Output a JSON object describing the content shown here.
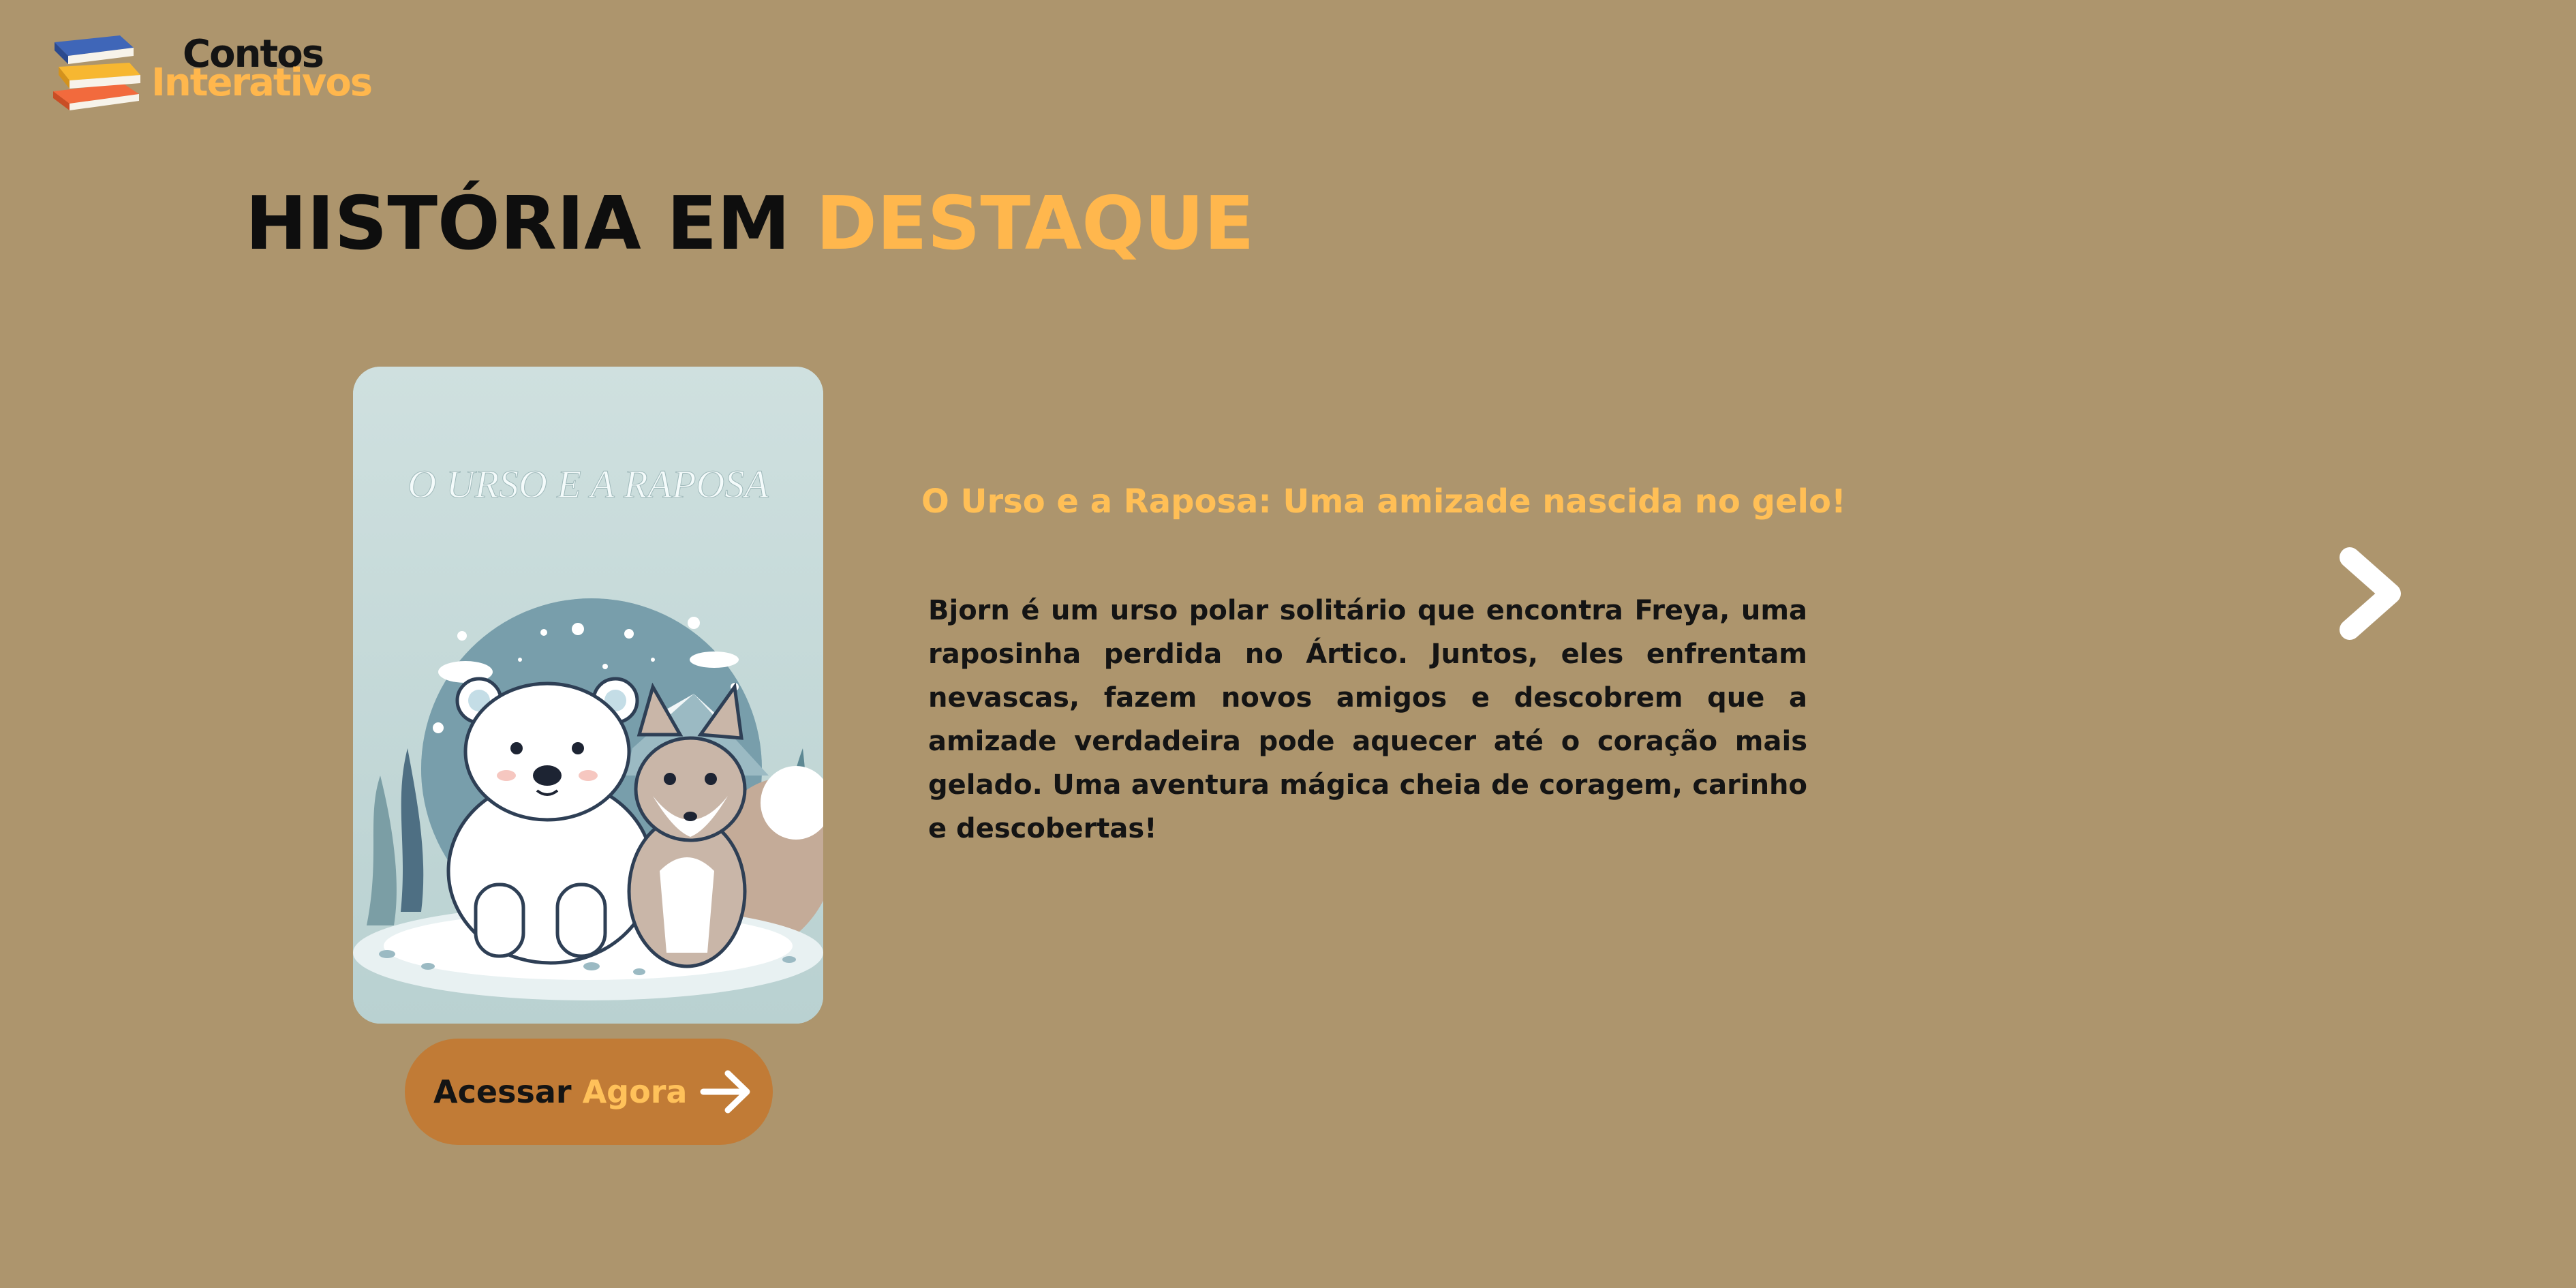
{
  "brand": {
    "line1": "Contos",
    "line2": "Interativos",
    "icon": "books-stack-icon"
  },
  "headline": {
    "main": "HISTÓRIA EM ",
    "accent": "DESTAQUE"
  },
  "featured": {
    "cover_title": "O URSO E A RAPOSA",
    "cover_image": "polar-bear-and-fox-illustration",
    "title": "O Urso e a Raposa: Uma amizade nascida no gelo!",
    "description": "Bjorn é um urso polar solitário que encontra Freya, uma raposinha perdida no Ártico. Juntos, eles enfrentam nevascas, fazem novos amigos e descobrem que a amizade verdadeira pode aquecer até o coração mais gelado. Uma aventura mágica cheia de coragem, carinho e descobertas!",
    "cta": {
      "label_main": "Acessar ",
      "label_accent": "Agora",
      "icon": "arrow-right-icon"
    }
  },
  "carousel": {
    "next_icon": "chevron-right-icon"
  },
  "colors": {
    "background": "#ad956d",
    "accent": "#ffb74d",
    "button": "#c17b36",
    "text": "#141414"
  }
}
